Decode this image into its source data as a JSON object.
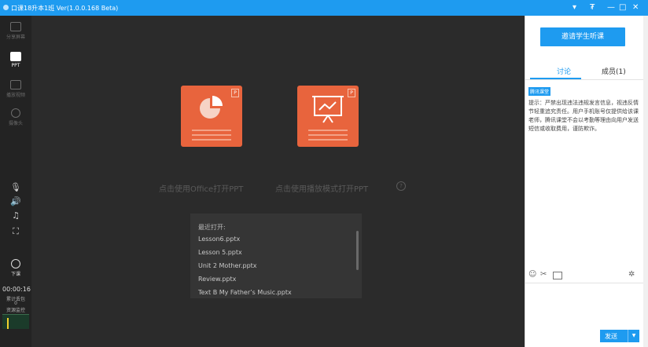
{
  "window": {
    "title": "口课18升本1班 Ver(1.0.0.168 Beta)",
    "controls": [
      "▾",
      "₮",
      "—",
      "□",
      "✕"
    ]
  },
  "sidebar": {
    "items": [
      {
        "label": "分享屏幕",
        "icon": "share-screen-icon"
      },
      {
        "label": "PPT",
        "icon": "ppt-icon"
      },
      {
        "label": "播放视频",
        "icon": "play-video-icon"
      },
      {
        "label": "摄像头",
        "icon": "camera-icon"
      }
    ],
    "end_class_label": "下课",
    "timer": "00:00:16",
    "stats_label": "累计丢包",
    "stats_value": "0",
    "monitor_label": "资源监控"
  },
  "main": {
    "open_office_label": "点击使用Office打开PPT",
    "open_play_label": "点击使用播放模式打开PPT",
    "help": "?",
    "recent": {
      "title": "最近打开:",
      "files": [
        "Lesson6.pptx",
        "Lesson 5.pptx",
        "Unit 2  Mother.pptx",
        "Review.pptx",
        "Text B My Father’s Music.pptx"
      ]
    }
  },
  "right": {
    "invite_label": "邀请学生听课",
    "tabs": {
      "discuss": "讨论",
      "members": "成员(1)"
    },
    "badge": "腾讯课堂",
    "notice": "提示：严禁出现违法违规发言信息，视违反情节轻重追究责任。用户手机账号仅提供给该课老师，腾讯课堂不会以考勤等理由向用户发送短信或收取费用，谨防欺诈。",
    "send_label": "发送"
  },
  "colors": {
    "accent": "#1e9bf0",
    "card": "#e8643d"
  }
}
